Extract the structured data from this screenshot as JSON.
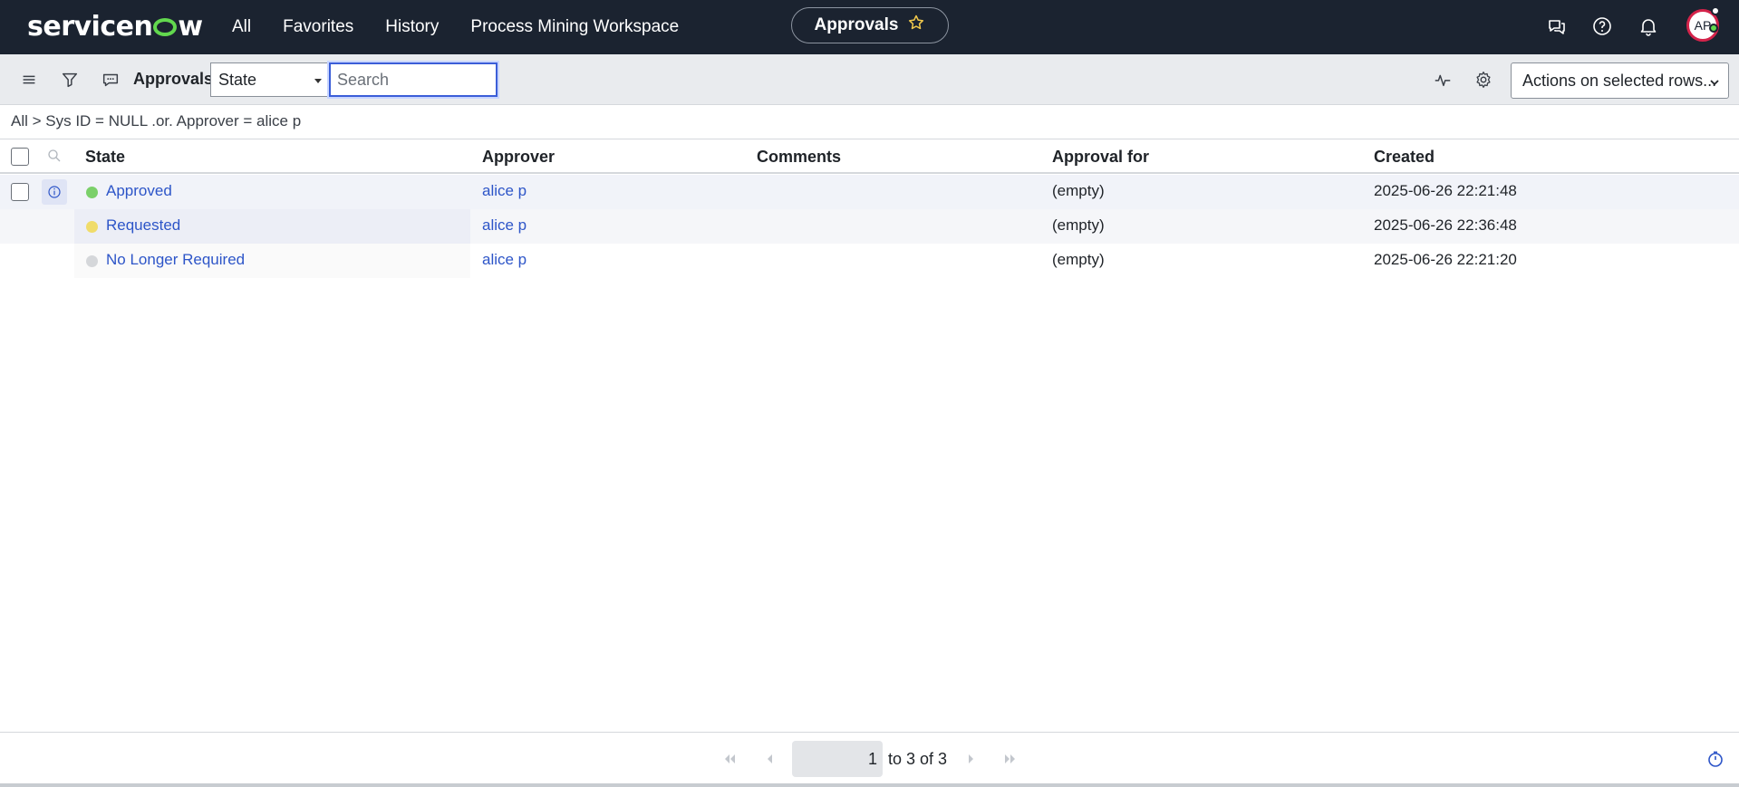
{
  "brand": {
    "logo_text_a": "servicen",
    "logo_text_b": "w"
  },
  "nav": {
    "items": [
      "All",
      "Favorites",
      "History",
      "Process Mining Workspace"
    ],
    "context_title": "Approvals"
  },
  "user": {
    "initials": "AP"
  },
  "toolbar": {
    "list_title": "Approvals",
    "field_select_value": "State",
    "search_placeholder": "Search",
    "actions_label": "Actions on selected rows..."
  },
  "breadcrumb": {
    "text": "All > Sys ID = NULL .or. Approver = alice p"
  },
  "table": {
    "columns": [
      "State",
      "Approver",
      "Comments",
      "Approval for",
      "Created"
    ],
    "rows": [
      {
        "state": "Approved",
        "state_color": "#7bd06a",
        "approver": "alice p",
        "comments": "",
        "approval_for": "(empty)",
        "created": "2025-06-26 22:21:48"
      },
      {
        "state": "Requested",
        "state_color": "#f0dc6a",
        "approver": "alice p",
        "comments": "",
        "approval_for": "(empty)",
        "created": "2025-06-26 22:36:48"
      },
      {
        "state": "No Longer Required",
        "state_color": "#d5d7da",
        "approver": "alice p",
        "comments": "",
        "approval_for": "(empty)",
        "created": "2025-06-26 22:21:20"
      }
    ]
  },
  "pagination": {
    "current": "1",
    "range_text": "to 3 of 3"
  },
  "colors": {
    "nav_bg": "#1b2330",
    "link": "#2d55c8",
    "accent": "#62d84e"
  }
}
